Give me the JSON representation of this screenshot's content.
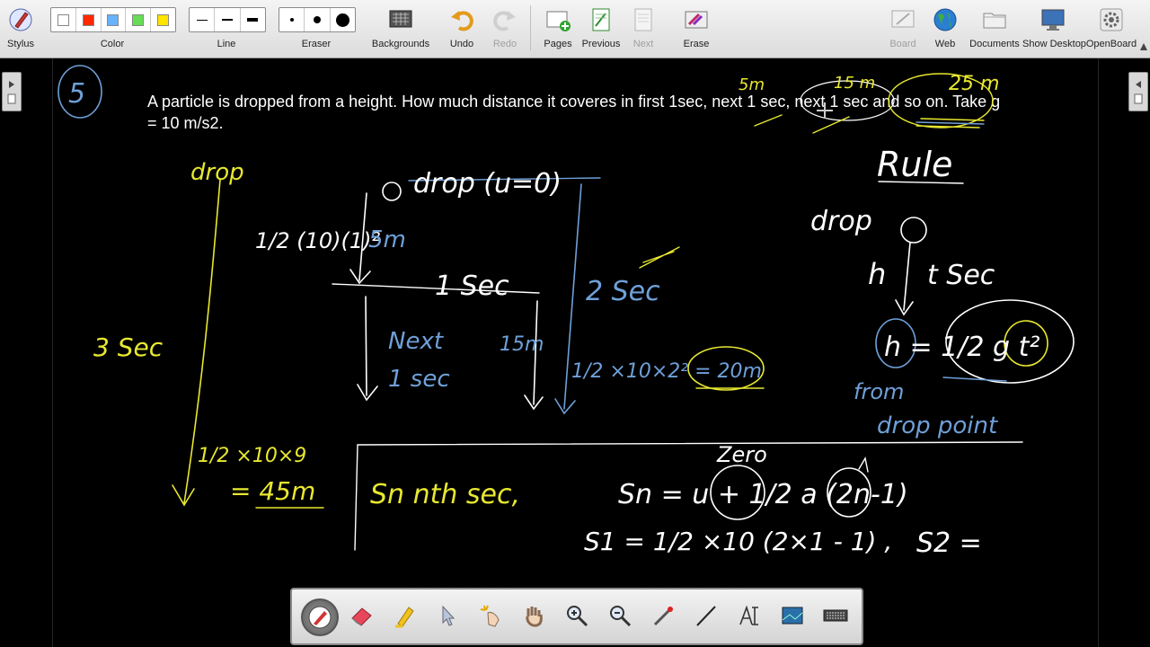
{
  "toolbar": {
    "stylus": "Stylus",
    "color": "Color",
    "line": "Line",
    "eraser": "Eraser",
    "backgrounds": "Backgrounds",
    "undo": "Undo",
    "redo": "Redo",
    "pages": "Pages",
    "previous": "Previous",
    "next": "Next",
    "erase": "Erase",
    "board": "Board",
    "web": "Web",
    "documents": "Documents",
    "show_desktop": "Show Desktop",
    "openboard": "OpenBoard"
  },
  "colors": {
    "swatches": [
      "#ffffff",
      "#ff2a00",
      "#66b2ff",
      "#66dd55",
      "#ffe400"
    ],
    "ink_yellow": "#e8e830",
    "ink_white": "#ffffff",
    "ink_blue": "#6fa0d8",
    "board_background": "#000000"
  },
  "board": {
    "question": "A particle is dropped from a height. How much distance it coveres in first 1sec, next 1 sec, next 1 sec and so on. Take g = 10 m/s2."
  },
  "handwriting": {
    "number": "5",
    "top_5m": "5m",
    "top_15m": "15 m",
    "top_25m": "25 m",
    "drop_left": "drop",
    "drop_u": "drop (u=0)",
    "half_formula": "1/2 (10)(1)²",
    "m5": "5m",
    "one_sec": "1 Sec",
    "two_sec": "2 Sec",
    "three_sec": "3 Sec",
    "next": "Next",
    "next_sec": "1 sec",
    "m15": "15m",
    "formula_2sec": "1/2 ×10×2² = 20m",
    "m20": "20m",
    "formula_3sec": "1/2 ×10×9",
    "m45": "= 45m",
    "rule": "Rule",
    "drop_right": "drop",
    "h": "h",
    "t_sec": "t Sec",
    "rule_formula": "h = 1/2 g t²",
    "from": "from",
    "drop_point": "drop point",
    "sn_intro": "Sn nth sec,",
    "zero": "Zero",
    "sn_formula": "Sn = u + 1/2 a (2n-1)",
    "s1_formula": "S1 = 1/2 ×10 (2×1 - 1) ,",
    "s2_formula": "S2 ="
  },
  "dock_tools": [
    "pen-tool",
    "eraser-tool",
    "marker-tool",
    "selector-tool",
    "laser-pointer-tool",
    "hand-tool",
    "zoom-in-tool",
    "zoom-out-tool",
    "pointer-tool",
    "line-tool",
    "text-tool",
    "capture-tool",
    "keyboard-tool"
  ]
}
